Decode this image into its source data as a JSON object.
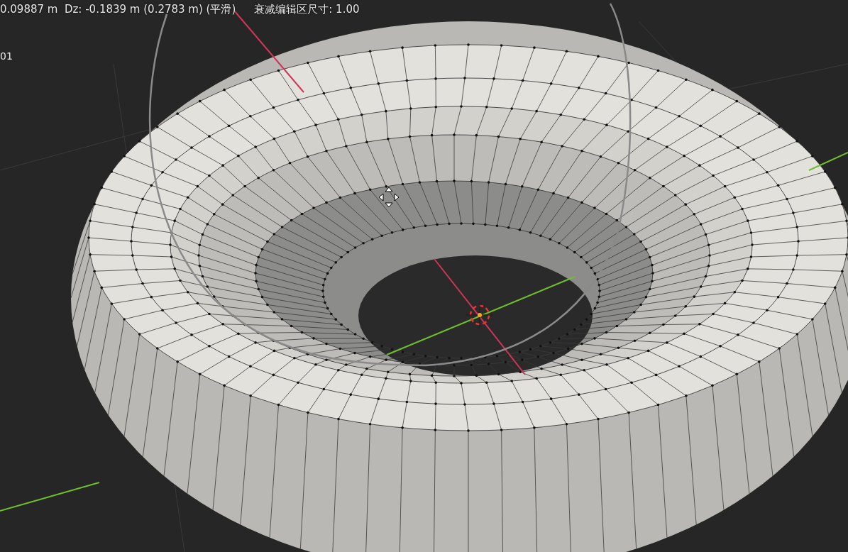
{
  "viewport": {
    "header": {
      "status": "0.09887 m  Dz: -0.1839 m (0.2783 m) (平滑)",
      "falloff": "衰减编辑区尺寸: 1.00"
    },
    "info_line": "01"
  }
}
